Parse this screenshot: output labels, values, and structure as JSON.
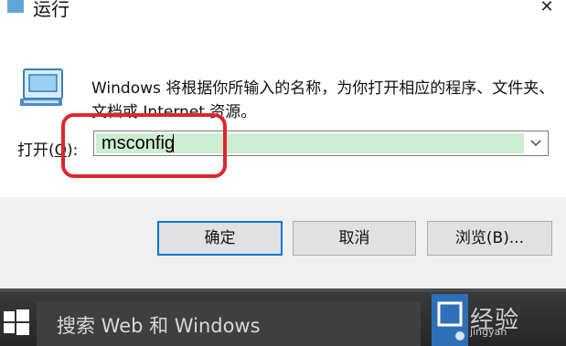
{
  "window": {
    "title": "运行",
    "close_glyph": "✕"
  },
  "dialog": {
    "description": "Windows 将根据你所输入的名称，为你打开相应的程序、文件夹、文档或 Internet 资源。",
    "open_label_prefix": "打开(",
    "open_label_key": "O",
    "open_label_suffix": "):",
    "command_value": "msconfig",
    "buttons": {
      "ok": "确定",
      "cancel": "取消",
      "browse": "浏览(B)..."
    }
  },
  "taskbar": {
    "search_placeholder": "搜索 Web 和 Windows",
    "watermark": "经验",
    "watermark_sub": "jingyan"
  },
  "colors": {
    "input_highlight": "#cdeed2",
    "annotation_red": "#e0262d",
    "default_button_border": "#0078d7",
    "taskbar_bg": "#2b2b2b"
  },
  "icons": {
    "title": "run-app-icon",
    "run": "run-dialog-icon",
    "dropdown": "chevron-down-icon",
    "close": "close-icon",
    "start": "windows-start-icon"
  }
}
